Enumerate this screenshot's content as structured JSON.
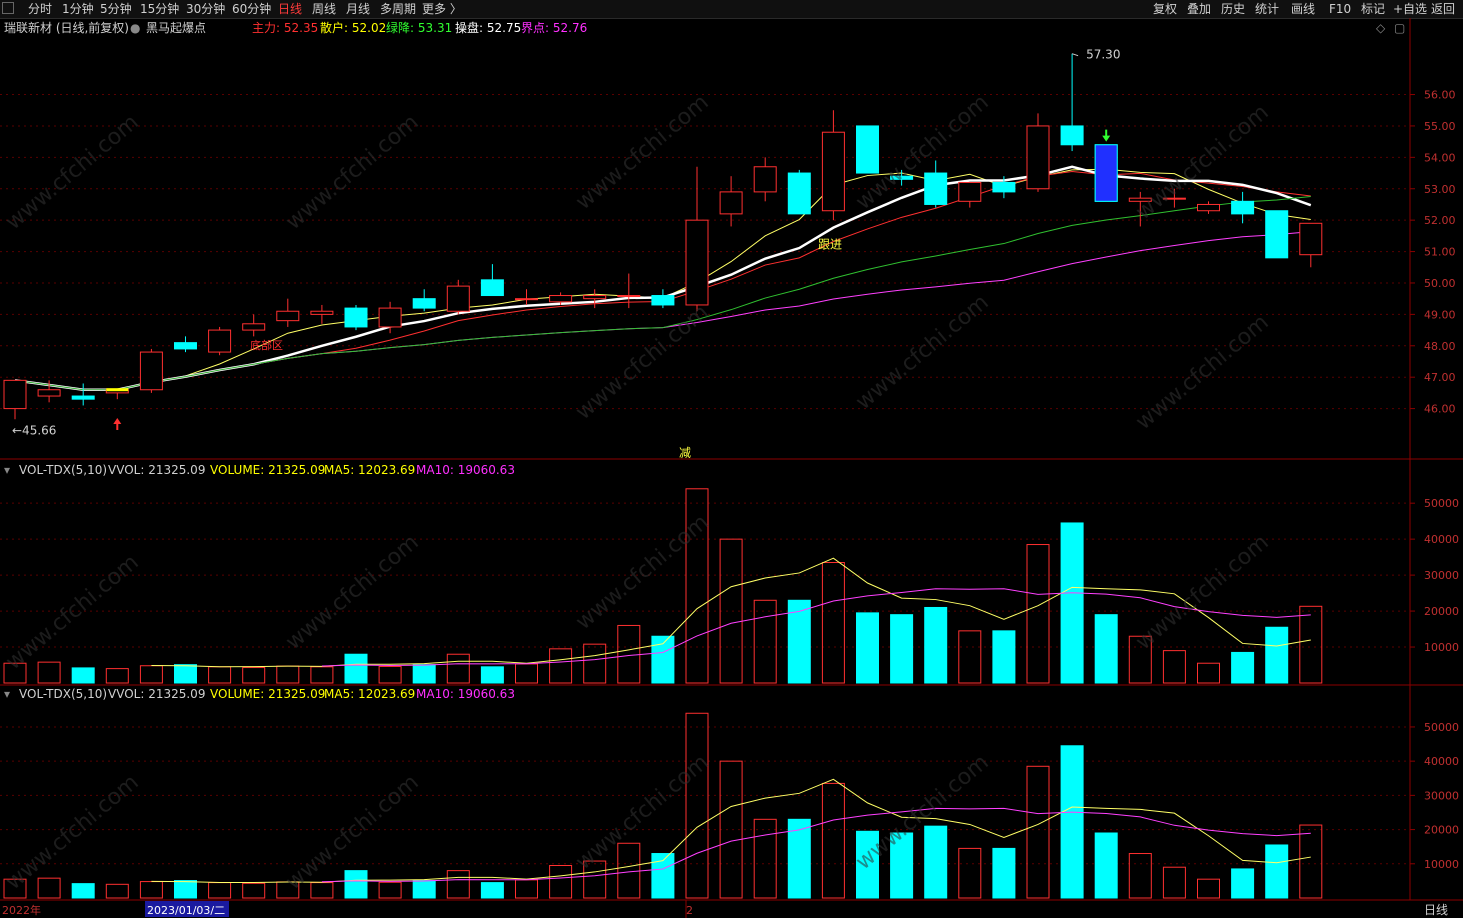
{
  "toolbar": {
    "periods": [
      "分时",
      "1分钟",
      "5分钟",
      "15分钟",
      "30分钟",
      "60分钟",
      "日线",
      "周线",
      "月线",
      "多周期",
      "更多 〉"
    ],
    "active_period": "日线",
    "right_tools": [
      "复权",
      "叠加",
      "历史",
      "统计",
      "画线",
      "F10",
      "标记",
      "+自选",
      "返回"
    ]
  },
  "main_header": {
    "stock": "瑞联新材 (日线,前复权)",
    "indicator": "黑马起爆点",
    "values": [
      {
        "label": "主力:",
        "value": "52.35",
        "color": "#ff3030"
      },
      {
        "label": "散户:",
        "value": "52.02",
        "color": "#ffff00"
      },
      {
        "label": "绿降:",
        "value": "53.31",
        "color": "#30ff30"
      },
      {
        "label": "操盘:",
        "value": "52.75",
        "color": "#ffffff"
      },
      {
        "label": "界点:",
        "value": "52.76",
        "color": "#ff30ff"
      }
    ]
  },
  "vol_header": {
    "name": "VOL-TDX(5,10)",
    "vvol": "VVOL: 21325.09",
    "volume": "VOLUME: 21325.09",
    "ma5": "MA5: 12023.69",
    "ma10": "MA10: 19060.63"
  },
  "annotations": {
    "high": "57.30",
    "low": "45.66",
    "follow": "跟进",
    "reduce": "减",
    "bottom_low_label": "底部区"
  },
  "watermark": "www.cfchi.com",
  "bottom_bar": {
    "year": "2022年",
    "date": "2023/01/03/二",
    "month": "2",
    "period": "日线"
  },
  "chart_data": {
    "type": "candlestick",
    "price_axis": {
      "ticks": [
        "56.00",
        "55.00",
        "54.00",
        "53.00",
        "52.00",
        "51.00",
        "50.00",
        "49.00",
        "48.00",
        "47.00",
        "46.00"
      ],
      "range": [
        45.0,
        57.8
      ]
    },
    "volume_axis": {
      "ticks": [
        "50000",
        "40000",
        "30000",
        "20000",
        "10000"
      ],
      "range": [
        0,
        57000
      ]
    },
    "candles": [
      {
        "o": 46.0,
        "h": 46.9,
        "l": 45.66,
        "c": 46.9,
        "v": 5500
      },
      {
        "o": 46.4,
        "h": 46.9,
        "l": 46.2,
        "c": 46.6,
        "v": 5800
      },
      {
        "o": 46.4,
        "h": 46.8,
        "l": 46.1,
        "c": 46.3,
        "v": 4200
      },
      {
        "o": 46.5,
        "h": 46.6,
        "l": 46.3,
        "c": 46.6,
        "v": 4000
      },
      {
        "o": 46.6,
        "h": 47.9,
        "l": 46.5,
        "c": 47.8,
        "v": 4800
      },
      {
        "o": 48.1,
        "h": 48.3,
        "l": 47.8,
        "c": 47.9,
        "v": 5100
      },
      {
        "o": 47.8,
        "h": 48.6,
        "l": 47.7,
        "c": 48.5,
        "v": 4500
      },
      {
        "o": 48.5,
        "h": 49.0,
        "l": 48.3,
        "c": 48.7,
        "v": 4300
      },
      {
        "o": 48.8,
        "h": 49.5,
        "l": 48.6,
        "c": 49.1,
        "v": 4700
      },
      {
        "o": 49.0,
        "h": 49.3,
        "l": 48.7,
        "c": 49.1,
        "v": 4500
      },
      {
        "o": 49.2,
        "h": 49.3,
        "l": 48.5,
        "c": 48.6,
        "v": 8000
      },
      {
        "o": 48.6,
        "h": 49.4,
        "l": 48.4,
        "c": 49.2,
        "v": 4600
      },
      {
        "o": 49.5,
        "h": 49.8,
        "l": 49.1,
        "c": 49.2,
        "v": 5100
      },
      {
        "o": 49.1,
        "h": 50.1,
        "l": 49.0,
        "c": 49.9,
        "v": 8000
      },
      {
        "o": 50.1,
        "h": 50.6,
        "l": 49.6,
        "c": 49.6,
        "v": 4500
      },
      {
        "o": 49.5,
        "h": 49.8,
        "l": 49.3,
        "c": 49.5,
        "v": 5300
      },
      {
        "o": 49.4,
        "h": 49.7,
        "l": 49.3,
        "c": 49.6,
        "v": 9500
      },
      {
        "o": 49.5,
        "h": 49.8,
        "l": 49.2,
        "c": 49.6,
        "v": 10800
      },
      {
        "o": 49.6,
        "h": 50.3,
        "l": 49.2,
        "c": 49.6,
        "v": 16000
      },
      {
        "o": 49.6,
        "h": 49.8,
        "l": 49.2,
        "c": 49.3,
        "v": 13000
      },
      {
        "o": 49.3,
        "h": 53.7,
        "l": 49.1,
        "c": 52.0,
        "v": 54000
      },
      {
        "o": 52.2,
        "h": 53.4,
        "l": 51.8,
        "c": 52.9,
        "v": 40000
      },
      {
        "o": 52.9,
        "h": 54.0,
        "l": 52.6,
        "c": 53.7,
        "v": 23000
      },
      {
        "o": 53.5,
        "h": 53.6,
        "l": 52.2,
        "c": 52.2,
        "v": 23000
      },
      {
        "o": 52.3,
        "h": 55.5,
        "l": 52.0,
        "c": 54.8,
        "v": 33500
      },
      {
        "o": 55.0,
        "h": 55.0,
        "l": 53.5,
        "c": 53.5,
        "v": 19500
      },
      {
        "o": 53.4,
        "h": 53.6,
        "l": 53.1,
        "c": 53.3,
        "v": 19000
      },
      {
        "o": 53.5,
        "h": 53.9,
        "l": 52.4,
        "c": 52.5,
        "v": 21000
      },
      {
        "o": 52.6,
        "h": 53.2,
        "l": 52.4,
        "c": 53.2,
        "v": 14500
      },
      {
        "o": 53.2,
        "h": 53.4,
        "l": 52.7,
        "c": 52.9,
        "v": 14500
      },
      {
        "o": 53.0,
        "h": 55.4,
        "l": 52.9,
        "c": 55.0,
        "v": 38500
      },
      {
        "o": 55.0,
        "h": 57.3,
        "l": 54.2,
        "c": 54.4,
        "v": 44500
      },
      {
        "o": 54.4,
        "h": 54.4,
        "l": 52.6,
        "c": 52.6,
        "v": 19000
      },
      {
        "o": 52.6,
        "h": 52.9,
        "l": 51.8,
        "c": 52.7,
        "v": 13000
      },
      {
        "o": 52.7,
        "h": 53.0,
        "l": 52.4,
        "c": 52.7,
        "v": 9000
      },
      {
        "o": 52.3,
        "h": 52.6,
        "l": 52.2,
        "c": 52.5,
        "v": 5500
      },
      {
        "o": 52.6,
        "h": 52.9,
        "l": 51.9,
        "c": 52.2,
        "v": 8500
      },
      {
        "o": 52.3,
        "h": 52.3,
        "l": 50.8,
        "c": 50.8,
        "v": 15500
      },
      {
        "o": 50.9,
        "h": 51.9,
        "l": 50.5,
        "c": 51.9,
        "v": 21325
      }
    ]
  }
}
